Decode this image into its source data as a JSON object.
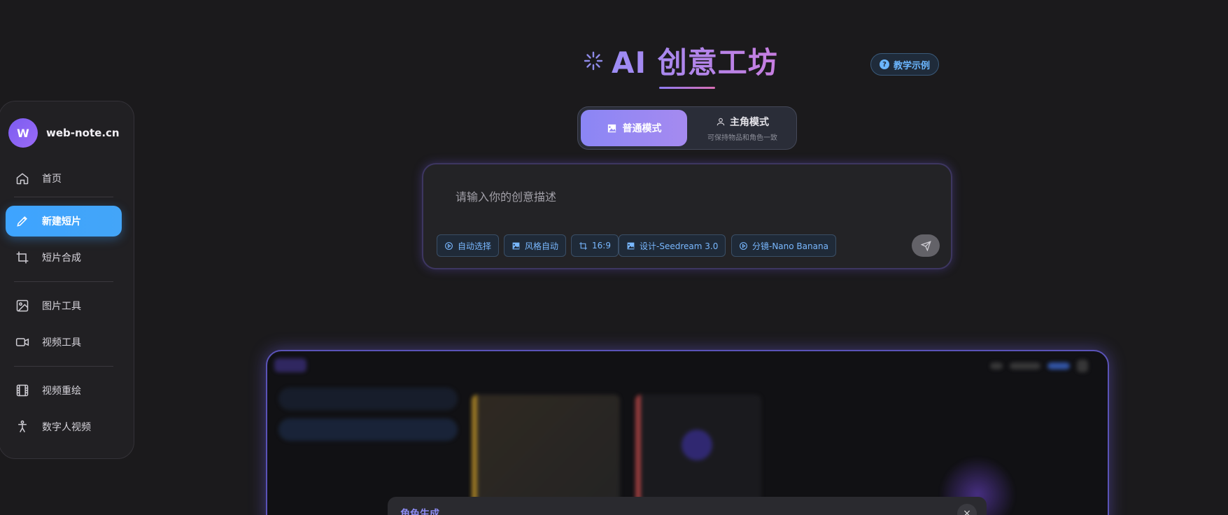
{
  "sidebar": {
    "brand": {
      "avatar_letter": "W",
      "name": "web-note.cn"
    },
    "items": [
      {
        "label": "首页",
        "icon": "home-icon"
      },
      {
        "label": "新建短片",
        "icon": "pen-icon",
        "active": true
      },
      {
        "label": "短片合成",
        "icon": "crop-icon"
      },
      {
        "label": "图片工具",
        "icon": "image-icon"
      },
      {
        "label": "视频工具",
        "icon": "video-icon"
      },
      {
        "label": "视频重绘",
        "icon": "film-icon"
      },
      {
        "label": "数字人视频",
        "icon": "person-icon"
      }
    ]
  },
  "header": {
    "title": "AI 创意工坊",
    "help_label": "教学示例"
  },
  "modes": {
    "normal": {
      "label": "普通模式",
      "active": true
    },
    "hero": {
      "label": "主角模式",
      "subtitle": "可保持物品和角色一致"
    }
  },
  "prompt": {
    "placeholder": "请输入你的创意描述",
    "value": "",
    "chips": [
      {
        "label": "自动选择",
        "icon": "play-circle-icon"
      },
      {
        "label": "风格自动",
        "icon": "image-icon"
      },
      {
        "label": "16:9",
        "icon": "crop-icon"
      },
      {
        "label": "设计-Seedream 3.0",
        "icon": "image-icon"
      },
      {
        "label": "分镜-Nano Banana",
        "icon": "play-circle-icon"
      }
    ]
  },
  "preview": {
    "dialog_title": "角色生成",
    "close_label": "×"
  },
  "colors": {
    "accent_blue": "#3ea4ff",
    "accent_purple": "#8b86f5",
    "chip_text": "#79b8ff",
    "background": "#1b1a1c"
  }
}
